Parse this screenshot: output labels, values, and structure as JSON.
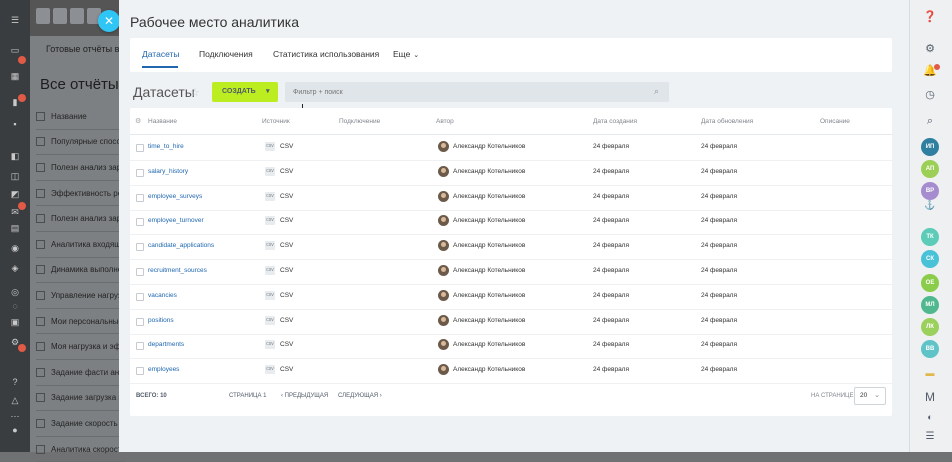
{
  "background": {
    "breadcrumb": "Готовые отчёты в Ма",
    "heading": "Все отчёты",
    "rows": [
      "Название",
      "Популярные способы",
      "Полезн анализ зарпл",
      "Эффективность рекл",
      "Полезн анализ зарп",
      "Аналитика входящих",
      "Динамика выполнени",
      "Управление нагрузк",
      "Мои персональные",
      "Моя нагрузка и эффе",
      "Задание фасти анали",
      "Задание загрузка ите",
      "Задание скорость раб",
      "Аналитика скорости"
    ]
  },
  "slider": {
    "title": "Рабочее место аналитика",
    "tabs": [
      {
        "label": "Датасеты",
        "active": true
      },
      {
        "label": "Подключения",
        "active": false
      },
      {
        "label": "Статистика использования",
        "active": false
      },
      {
        "label": "Еще",
        "active": false
      }
    ]
  },
  "datasets": {
    "title": "Датасеты",
    "create_label": "СОЗДАТЬ",
    "search_placeholder": "Фильтр + поиск"
  },
  "table": {
    "columns": [
      "Название",
      "Источник",
      "Подключение",
      "Автор",
      "Дата создания",
      "Дата обновления",
      "Описание"
    ],
    "rows": [
      {
        "name": "time_to_hire",
        "source": "CSV",
        "author": "Александр Котельников",
        "created": "24 февраля",
        "updated": "24 февраля"
      },
      {
        "name": "salary_history",
        "source": "CSV",
        "author": "Александр Котельников",
        "created": "24 февраля",
        "updated": "24 февраля"
      },
      {
        "name": "employee_surveys",
        "source": "CSV",
        "author": "Александр Котельников",
        "created": "24 февраля",
        "updated": "24 февраля"
      },
      {
        "name": "employee_turnover",
        "source": "CSV",
        "author": "Александр Котельников",
        "created": "24 февраля",
        "updated": "24 февраля"
      },
      {
        "name": "candidate_applications",
        "source": "CSV",
        "author": "Александр Котельников",
        "created": "24 февраля",
        "updated": "24 февраля"
      },
      {
        "name": "recruitment_sources",
        "source": "CSV",
        "author": "Александр Котельников",
        "created": "24 февраля",
        "updated": "24 февраля"
      },
      {
        "name": "vacancies",
        "source": "CSV",
        "author": "Александр Котельников",
        "created": "24 февраля",
        "updated": "24 февраля"
      },
      {
        "name": "positions",
        "source": "CSV",
        "author": "Александр Котельников",
        "created": "24 февраля",
        "updated": "24 февраля"
      },
      {
        "name": "departments",
        "source": "CSV",
        "author": "Александр Котельников",
        "created": "24 февраля",
        "updated": "24 февраля"
      },
      {
        "name": "employees",
        "source": "CSV",
        "author": "Александр Котельников",
        "created": "24 февраля",
        "updated": "24 февраля"
      }
    ],
    "footer": {
      "total": "ВСЕГО: 10",
      "page": "СТРАНИЦА 1",
      "prev": "‹ ПРЕДЫДУЩАЯ",
      "next": "СЛЕДУЮЩАЯ ›",
      "per_page_label": "НА СТРАНИЦЕ:",
      "per_page_value": "20"
    }
  },
  "rightbar": {
    "avatars": [
      {
        "text": "ИП",
        "color": "#2e7fa0"
      },
      {
        "text": "АП",
        "color": "#9ccf55"
      },
      {
        "text": "ВР",
        "color": "#a68ccf"
      },
      {
        "text": "ТК",
        "color": "#5ccbb7"
      },
      {
        "text": "СК",
        "color": "#49c1d6"
      },
      {
        "text": "ОЕ",
        "color": "#8bcc4a"
      },
      {
        "text": "МЛ",
        "color": "#4fb88e"
      },
      {
        "text": "ЛК",
        "color": "#9bd05c"
      },
      {
        "text": "ВВ",
        "color": "#5fc3c7"
      }
    ]
  }
}
